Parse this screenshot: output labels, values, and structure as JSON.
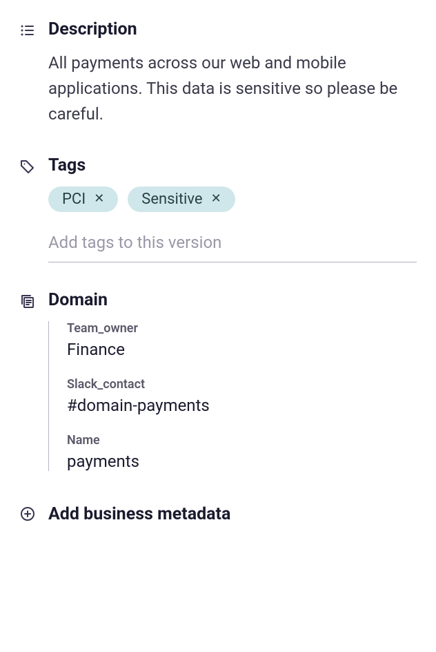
{
  "description": {
    "title": "Description",
    "text": "All payments across our web and mobile applications. This data is sensitive so please be careful."
  },
  "tags": {
    "title": "Tags",
    "chips": [
      {
        "label": "PCI"
      },
      {
        "label": "Sensitive"
      }
    ],
    "input_placeholder": "Add tags to this version"
  },
  "domain": {
    "title": "Domain",
    "items": [
      {
        "key": "Team_owner",
        "value": "Finance"
      },
      {
        "key": "Slack_contact",
        "value": "#domain-payments"
      },
      {
        "key": "Name",
        "value": "payments"
      }
    ]
  },
  "add_metadata": {
    "label": "Add business metadata"
  }
}
